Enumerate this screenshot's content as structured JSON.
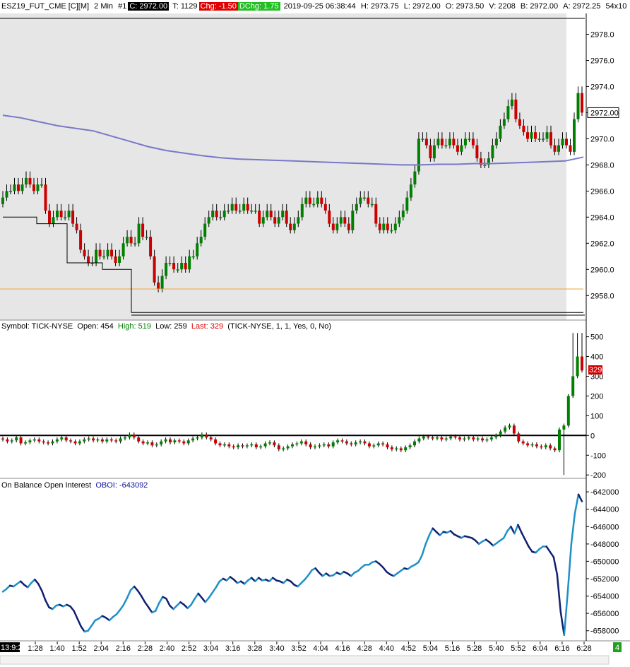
{
  "header": {
    "symbol": "ESZ19_FUT_CME [C][M]",
    "interval": "2 Min",
    "chart_num": "#1",
    "close": "C: 2972.00",
    "ticks": "T: 1129",
    "chg": "Chg: -1.50",
    "dchg": "DChg: 1.75",
    "timestamp": "2019-09-25 06:38:44",
    "high": "H: 2973.75",
    "low": "L: 2972.00",
    "open": "O: 2973.50",
    "volume": "V: 2208",
    "bid": "B: 2972.00",
    "ask": "A: 2972.25",
    "extra": "54x10"
  },
  "tick_panel": {
    "label_symbol": "Symbol: TICK-NYSE",
    "label_open": "Open: 454",
    "label_high": "High: 519",
    "label_low": "Low: 259",
    "label_last": "Last: 329",
    "params": "(TICK-NYSE, 1, 1, Yes, 0, No)",
    "last_marker": "329"
  },
  "oboi_panel": {
    "label_name": "On Balance Open Interest",
    "label_value": "OBOI: -643092"
  },
  "time_axis": {
    "first_label": "13:9:25",
    "labels": [
      "1:28",
      "1:40",
      "1:52",
      "2:04",
      "2:16",
      "2:28",
      "2:40",
      "2:52",
      "3:04",
      "3:16",
      "3:28",
      "3:40",
      "3:52",
      "4:04",
      "4:16",
      "4:28",
      "4:40",
      "4:52",
      "5:04",
      "5:16",
      "5:28",
      "5:40",
      "5:52",
      "6:04",
      "6:16",
      "6:28"
    ]
  },
  "status_badge": "4",
  "colors": {
    "shaded_bg": "#e6e6e6",
    "up": "#008000",
    "down": "#cc0000",
    "vwap": "#7878c8",
    "level_line": "#f0a040",
    "oboi_light": "#1e90c8",
    "oboi_dark": "#102070"
  },
  "chart_data": [
    {
      "type": "candlestick",
      "title": "ESZ19_FUT_CME [C][M] 2 Min",
      "ylim": [
        2956.5,
        2979
      ],
      "yticks": [
        2958,
        2960,
        2962,
        2964,
        2966,
        2968,
        2970,
        2972,
        2974,
        2976,
        2978
      ],
      "last_price": "2972.00",
      "closes": [
        2965.5,
        2966,
        2966,
        2966.5,
        2966,
        2966.5,
        2967,
        2966.5,
        2966,
        2966.5,
        2966.5,
        2964.5,
        2963.5,
        2964,
        2964.5,
        2964,
        2964,
        2964.5,
        2963.5,
        2963,
        2961.5,
        2961,
        2960.5,
        2960.5,
        2961.5,
        2961,
        2961,
        2961.5,
        2961,
        2960.5,
        2961,
        2962,
        2962.5,
        2962,
        2962,
        2963.5,
        2962.5,
        2962.5,
        2961,
        2959,
        2958.5,
        2959.5,
        2960.5,
        2960.5,
        2960,
        2960,
        2960.5,
        2960,
        2961,
        2961,
        2962,
        2962.5,
        2963.5,
        2964,
        2964.5,
        2964,
        2964,
        2964.5,
        2964.5,
        2965,
        2964.5,
        2964.5,
        2965,
        2964.5,
        2964.5,
        2964.5,
        2963.5,
        2964,
        2964.5,
        2964,
        2963.5,
        2964,
        2964.5,
        2963.5,
        2963,
        2963.5,
        2964,
        2965,
        2965.5,
        2965,
        2965,
        2965.5,
        2965,
        2964.5,
        2963.5,
        2963,
        2963.5,
        2964,
        2963.5,
        2963,
        2964.5,
        2965,
        2965.5,
        2965.5,
        2965,
        2965,
        2963.5,
        2963,
        2963.5,
        2963,
        2963,
        2963.5,
        2964,
        2964.5,
        2965.5,
        2966.5,
        2967.5,
        2970,
        2970,
        2969.5,
        2968.5,
        2969.5,
        2970,
        2969.5,
        2969.5,
        2970,
        2969.5,
        2969,
        2969.5,
        2970,
        2970,
        2969.5,
        2968.5,
        2968,
        2968,
        2968.5,
        2969.5,
        2970,
        2971,
        2971.5,
        2972.5,
        2973,
        2971.5,
        2971,
        2970.5,
        2970,
        2970.5,
        2970,
        2970,
        2970,
        2970.5,
        2969.5,
        2969,
        2969.5,
        2970,
        2969.5,
        2969,
        2971.5,
        2973.5,
        2972
      ]
    },
    {
      "type": "candlestick",
      "title": "TICK-NYSE",
      "ylim": [
        -210,
        520
      ],
      "yticks": [
        -200,
        -100,
        0,
        100,
        200,
        300,
        400,
        500
      ],
      "open": 454,
      "high": 519,
      "low": 259,
      "last": 329,
      "closes": [
        -20,
        -30,
        -25,
        -10,
        -40,
        -35,
        -25,
        -20,
        -30,
        -35,
        -40,
        -30,
        -20,
        -10,
        -25,
        -30,
        -40,
        -30,
        -20,
        -15,
        -25,
        -20,
        -30,
        -20,
        -25,
        -30,
        -15,
        -10,
        5,
        -10,
        -30,
        -40,
        -35,
        -50,
        -45,
        -30,
        -20,
        -35,
        -25,
        -30,
        -40,
        -25,
        -15,
        -10,
        5,
        -10,
        -20,
        -40,
        -50,
        -45,
        -55,
        -60,
        -50,
        -55,
        -50,
        -45,
        -60,
        -55,
        -40,
        -35,
        -50,
        -70,
        -65,
        -55,
        -45,
        -40,
        -30,
        -45,
        -60,
        -55,
        -50,
        -45,
        -55,
        -35,
        -25,
        -30,
        -40,
        -45,
        -35,
        -30,
        -40,
        -55,
        -50,
        -40,
        -45,
        -60,
        -70,
        -65,
        -75,
        -60,
        -50,
        -30,
        -15,
        -5,
        -10,
        -15,
        -10,
        -20,
        -15,
        -5,
        -10,
        -20,
        -15,
        -10,
        -20,
        -15,
        -25,
        -20,
        -10,
        0,
        20,
        40,
        50,
        10,
        -30,
        -40,
        -50,
        -45,
        -55,
        -60,
        -50,
        -65,
        -75,
        30,
        50,
        200,
        300,
        400,
        329
      ]
    },
    {
      "type": "line",
      "title": "On Balance Open Interest",
      "ylim": [
        -659000,
        -641500
      ],
      "yticks": [
        -642000,
        -644000,
        -646000,
        -648000,
        -650000,
        -652000,
        -654000,
        -656000,
        -658000
      ],
      "last_value": -643092,
      "values": [
        -653500,
        -653200,
        -652800,
        -652900,
        -652600,
        -652300,
        -652700,
        -653000,
        -652500,
        -652100,
        -652600,
        -653400,
        -654500,
        -655300,
        -655500,
        -655100,
        -655000,
        -655200,
        -655000,
        -655200,
        -655700,
        -656600,
        -657500,
        -658100,
        -658000,
        -657400,
        -656800,
        -656600,
        -656300,
        -656500,
        -656800,
        -656400,
        -656100,
        -655600,
        -655000,
        -654200,
        -653300,
        -652900,
        -653400,
        -654000,
        -654700,
        -655300,
        -655900,
        -655700,
        -654800,
        -654100,
        -654300,
        -655100,
        -655500,
        -655100,
        -654700,
        -655000,
        -655400,
        -655000,
        -654300,
        -653700,
        -654200,
        -654700,
        -654200,
        -653600,
        -653000,
        -652300,
        -652000,
        -652200,
        -651800,
        -652100,
        -652500,
        -652300,
        -652600,
        -652200,
        -651900,
        -652300,
        -651900,
        -652200,
        -652100,
        -652300,
        -651900,
        -652200,
        -652300,
        -652500,
        -652100,
        -652300,
        -652700,
        -652900,
        -652500,
        -652100,
        -651600,
        -651000,
        -650800,
        -651300,
        -651700,
        -651400,
        -651700,
        -651600,
        -651300,
        -651500,
        -651200,
        -651400,
        -651700,
        -651300,
        -651100,
        -650700,
        -650400,
        -650400,
        -650100,
        -650000,
        -650300,
        -650700,
        -651200,
        -651500,
        -651700,
        -651400,
        -651100,
        -650800,
        -650900,
        -650600,
        -650400,
        -650100,
        -649300,
        -648000,
        -647000,
        -646200,
        -646600,
        -647000,
        -646600,
        -646700,
        -646500,
        -646900,
        -647100,
        -647300,
        -647100,
        -647200,
        -647300,
        -647600,
        -648000,
        -647700,
        -647500,
        -647800,
        -648200,
        -647900,
        -647600,
        -647300,
        -646500,
        -646000,
        -646800,
        -645800,
        -646700,
        -647500,
        -648300,
        -648900,
        -649000,
        -648600,
        -648300,
        -648300,
        -648900,
        -649500,
        -651500,
        -655800,
        -658500,
        -653500,
        -648000,
        -644500,
        -642300,
        -643092
      ]
    }
  ]
}
